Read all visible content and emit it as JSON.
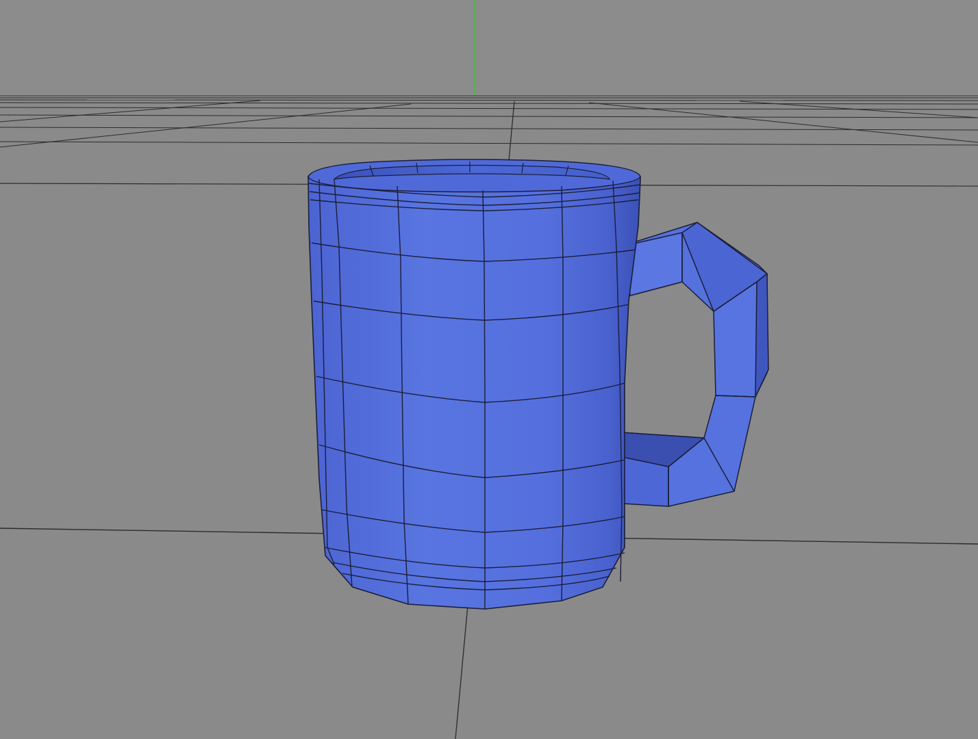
{
  "viewport": {
    "view_name": "Perspective",
    "background_color": "#8a8a8a",
    "grid_color": "#2a2a2a",
    "y_axis_color": "#3cc23c",
    "grid_visible": true
  },
  "scene": {
    "object_name": "mug",
    "object_type": "polygon-mesh",
    "shading_mode": "shaded-with-wireframe",
    "material_color": "#4f6ad8",
    "material_highlight_color": "#6b84ea",
    "material_shadow_color": "#3a4fb0",
    "wireframe_color": "#1b1d3a"
  }
}
